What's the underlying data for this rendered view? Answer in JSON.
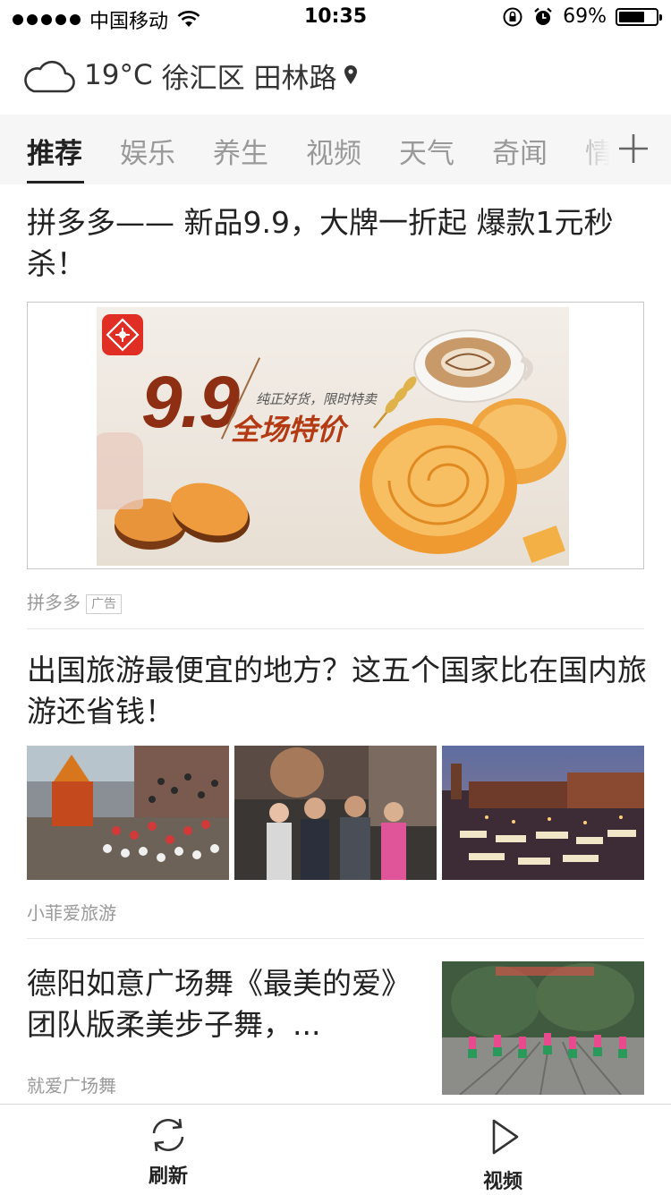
{
  "status_bar": {
    "carrier": "中国移动",
    "time": "10:35",
    "battery_text": "69%",
    "battery_level": 0.69
  },
  "weather": {
    "temperature": "19°C",
    "location": "徐汇区 田林路"
  },
  "tabs": [
    {
      "label": "推荐",
      "active": true
    },
    {
      "label": "娱乐"
    },
    {
      "label": "养生"
    },
    {
      "label": "视频"
    },
    {
      "label": "天气"
    },
    {
      "label": "奇闻"
    },
    {
      "label": "情"
    }
  ],
  "articles": [
    {
      "title": "拼多多—— 新品9.9，大牌一折起  爆款1元秒杀！",
      "source": "拼多多",
      "badge": "广告",
      "banner": {
        "price": "9.9",
        "slogan": "纯正好货，限时特卖",
        "headline": "全场特价"
      }
    },
    {
      "title": "出国旅游最便宜的地方？这五个国家比在国内旅游还省钱！",
      "source": "小菲爱旅游"
    },
    {
      "title": "德阳如意广场舞《最美的爱》团队版柔美步子舞，...",
      "source": "就爱广场舞"
    }
  ],
  "bottom_nav": {
    "refresh_label": "刷新",
    "video_label": "视频"
  },
  "colors": {
    "accent_red": "#e02e24",
    "tab_bg": "#f6f6f6",
    "text_primary": "#222222",
    "text_secondary": "#999999"
  }
}
